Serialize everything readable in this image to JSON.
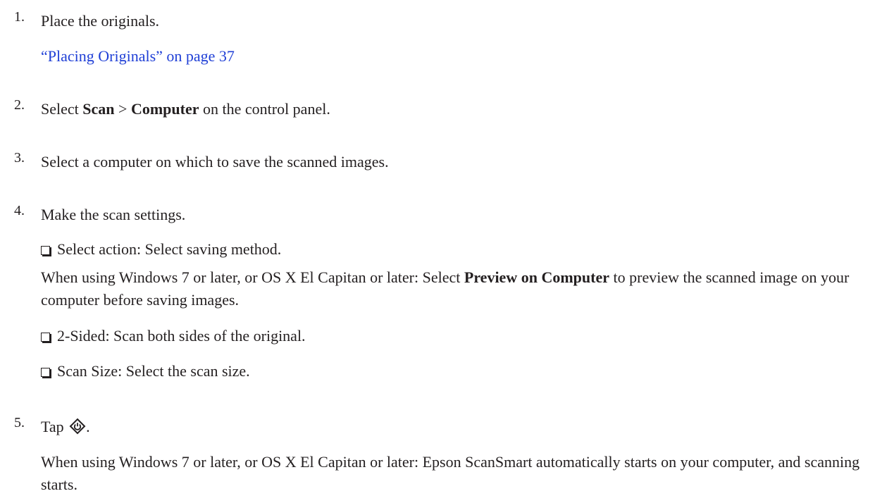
{
  "steps": [
    {
      "num": "1.",
      "text": "Place the originals.",
      "link": "“Placing Originals” on page 37"
    },
    {
      "num": "2.",
      "pre": "Select ",
      "b1": "Scan",
      "mid": " > ",
      "b2": "Computer",
      "post": " on the control panel."
    },
    {
      "num": "3.",
      "text": "Select a computer on which to save the scanned images."
    },
    {
      "num": "4.",
      "text": "Make the scan settings."
    },
    {
      "num": "5.",
      "pre": "Tap ",
      "post": ".",
      "note": "When using Windows 7 or later, or OS X El Capitan or later: Epson ScanSmart automatically starts on your computer, and scanning starts."
    }
  ],
  "settings": [
    {
      "label": "Select action: Select saving method.",
      "note_pre": "When using Windows 7 or later, or OS X El Capitan or later: Select ",
      "note_bold": "Preview on Computer",
      "note_post": " to preview the scanned image on your computer before saving images."
    },
    {
      "label": "2-Sided: Scan both sides of the original."
    },
    {
      "label": "Scan Size: Select the scan size."
    }
  ],
  "icons": {
    "start": "start-diamond-icon"
  }
}
